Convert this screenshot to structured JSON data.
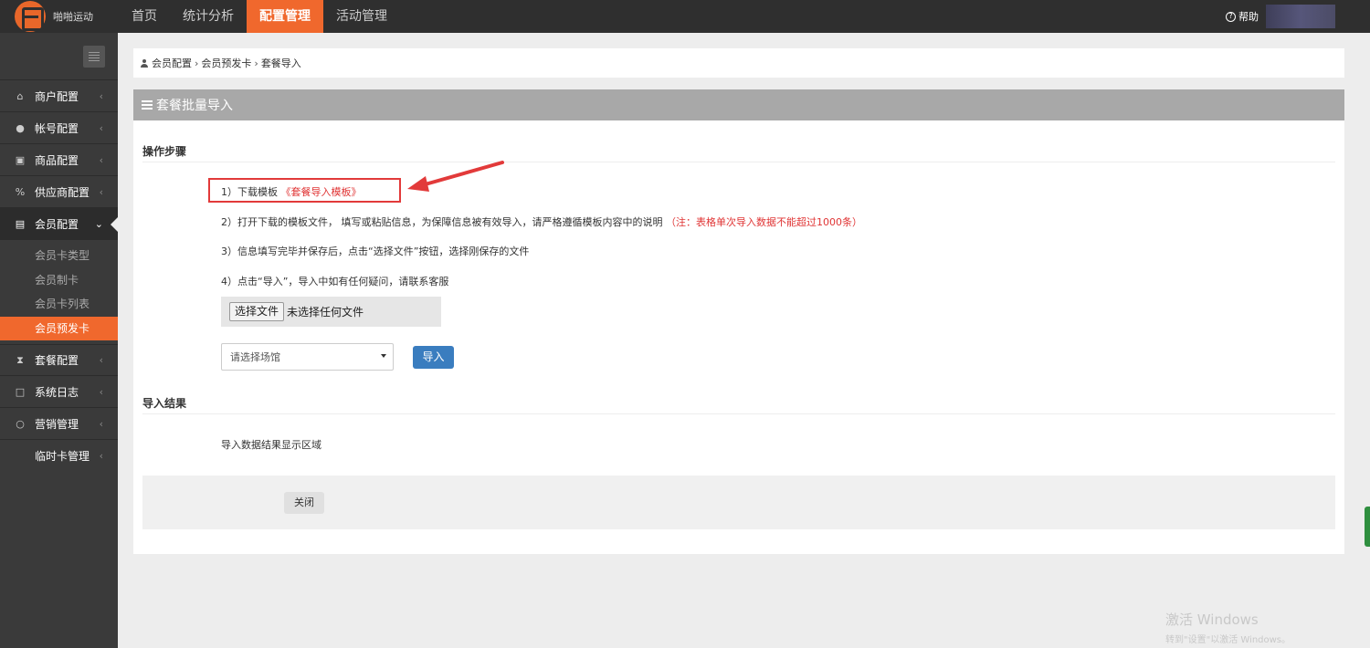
{
  "app": {
    "logo_text": "啪啪运动",
    "nav": [
      "首页",
      "统计分析",
      "配置管理",
      "活动管理"
    ],
    "active_nav": "配置管理",
    "help_label": "帮助"
  },
  "sidebar": {
    "items": [
      {
        "label": "商户配置",
        "icon": "home-icon"
      },
      {
        "label": "帐号配置",
        "icon": "user-icon"
      },
      {
        "label": "商品配置",
        "icon": "gift-icon"
      },
      {
        "label": "供应商配置",
        "icon": "link-icon"
      },
      {
        "label": "会员配置",
        "icon": "id-card-icon",
        "open": true
      },
      {
        "label": "套餐配置",
        "icon": "hourglass-icon"
      },
      {
        "label": "系统日志",
        "icon": "note-icon"
      },
      {
        "label": "营销管理",
        "icon": "circle-icon"
      },
      {
        "label": "临时卡管理",
        "icon": ""
      }
    ],
    "submenu": [
      "会员卡类型",
      "会员制卡",
      "会员卡列表",
      "会员预发卡"
    ],
    "active_sub": "会员预发卡"
  },
  "breadcrumb": [
    "会员配置",
    "会员预发卡",
    "套餐导入"
  ],
  "panel": {
    "title": "套餐批量导入",
    "steps_title": "操作步骤",
    "step1_prefix": "1）下载模板",
    "step1_link": "《套餐导入模板》",
    "step2_text": "2）打开下载的模板文件， 填写或粘贴信息，为保障信息被有效导入，请严格遵循模板内容中的说明",
    "step2_note": "（注：表格单次导入数据不能超过1000条）",
    "step3_text": "3）信息填写完毕并保存后，点击“选择文件”按钮，选择刚保存的文件",
    "step4_text": "4）点击“导入”，导入中如有任何疑问，请联系客服",
    "file_button": "选择文件",
    "file_status": "未选择任何文件",
    "venue_select": "请选择场馆",
    "import_button": "导入",
    "result_title": "导入结果",
    "result_text": "导入数据结果显示区域",
    "close_button": "关闭"
  },
  "watermark": {
    "line1": "激活 Windows",
    "line2": "转到\"设置\"以激活 Windows。"
  },
  "colors": {
    "accent": "#f0682d",
    "topbar": "#2f2f2f",
    "sidebar": "#3a3a3a",
    "link_red": "#e03535",
    "primary_button": "#3a7dbf"
  }
}
